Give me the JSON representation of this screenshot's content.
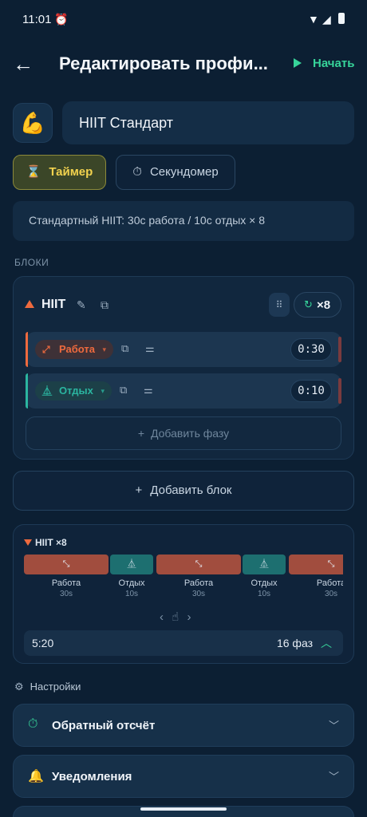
{
  "status": {
    "time": "11:01"
  },
  "appbar": {
    "title": "Редактировать профи...",
    "start_label": "Начать"
  },
  "profile": {
    "emoji": "💪",
    "name": "HIIT Стандарт"
  },
  "modes": {
    "timer": "Таймер",
    "stopwatch": "Секундомер"
  },
  "description": "Стандартный HIIT: 30с работа / 10с отдых × 8",
  "blocks_label": "БЛОКИ",
  "block": {
    "name": "HIIT",
    "repeat": "×8",
    "phases": [
      {
        "label": "Работа",
        "duration": "0:30"
      },
      {
        "label": "Отдых",
        "duration": "0:10"
      }
    ],
    "add_phase": "Добавить фазу"
  },
  "add_block": "Добавить блок",
  "timeline": {
    "header": "HIIT ×8",
    "segments": [
      {
        "label": "Работа",
        "sub": "30s"
      },
      {
        "label": "Отдых",
        "sub": "10s"
      },
      {
        "label": "Работа",
        "sub": "30s"
      },
      {
        "label": "Отдых",
        "sub": "10s"
      },
      {
        "label": "Работа",
        "sub": "30s"
      }
    ],
    "total_time": "5:20",
    "phase_count": "16 фаз"
  },
  "settings": {
    "label": "Настройки",
    "items": [
      {
        "label": "Обратный отсчёт",
        "icon": "timer-icon"
      },
      {
        "label": "Уведомления",
        "icon": "bell-icon"
      }
    ]
  },
  "colors": {
    "work": "#ee6a3e",
    "rest": "#2bb5a0",
    "accent": "#37d49a",
    "timer_tab": "#f2d24e"
  }
}
